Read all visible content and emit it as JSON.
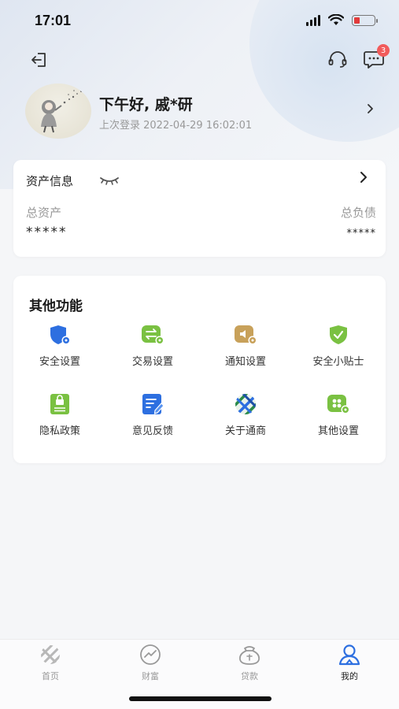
{
  "status_bar": {
    "time": "17:01"
  },
  "header": {
    "message_badge": "3"
  },
  "profile": {
    "greeting": "下午好, 戚*研",
    "last_login": "上次登录 2022-04-29 16:02:01"
  },
  "assets": {
    "title": "资产信息",
    "total_assets_label": "总资产",
    "total_assets_value": "*****",
    "total_debt_label": "总负债",
    "total_debt_value": "*****"
  },
  "functions": {
    "title": "其他功能",
    "items": [
      {
        "label": "安全设置",
        "icon": "shield-gear-icon"
      },
      {
        "label": "交易设置",
        "icon": "exchange-gear-icon"
      },
      {
        "label": "通知设置",
        "icon": "speaker-gear-icon"
      },
      {
        "label": "安全小贴士",
        "icon": "shield-check-icon"
      },
      {
        "label": "隐私政策",
        "icon": "privacy-lock-icon"
      },
      {
        "label": "意见反馈",
        "icon": "feedback-edit-icon"
      },
      {
        "label": "关于通商",
        "icon": "brand-logo-icon"
      },
      {
        "label": "其他设置",
        "icon": "apps-gear-icon"
      }
    ]
  },
  "tabbar": {
    "tabs": [
      {
        "label": "首页"
      },
      {
        "label": "财富"
      },
      {
        "label": "贷款"
      },
      {
        "label": "我的"
      }
    ],
    "active": "我的"
  },
  "colors": {
    "accent_blue": "#2d6fe0",
    "green": "#7ac142",
    "gold": "#c8a15a",
    "badge_red": "#f15b5b"
  }
}
